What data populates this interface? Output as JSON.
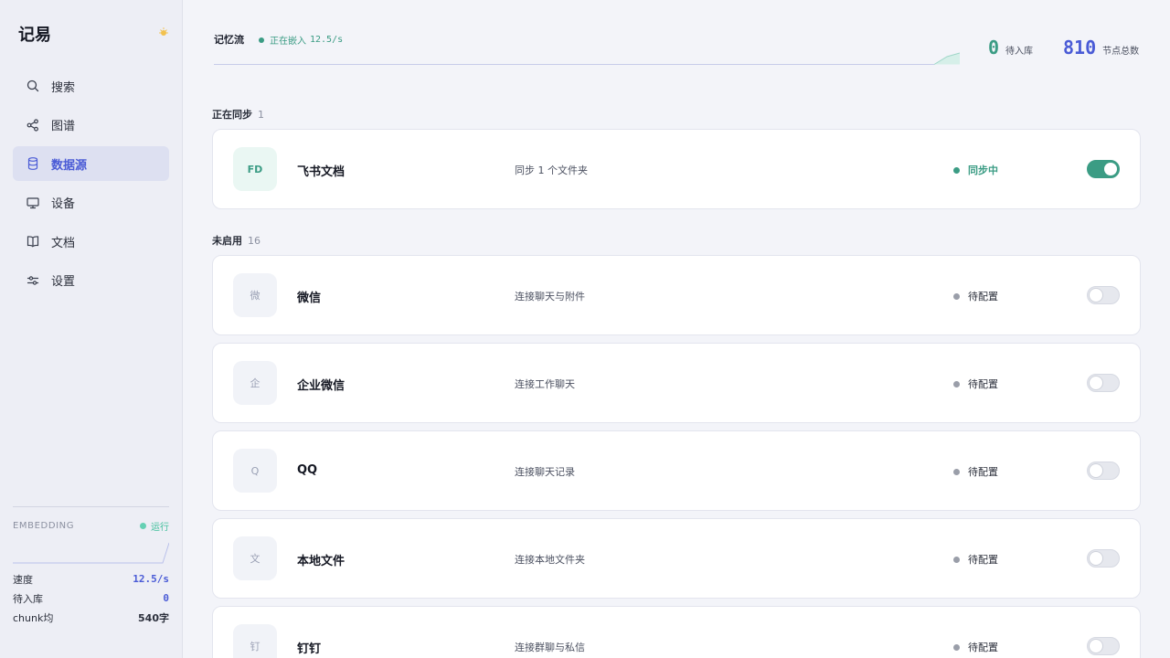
{
  "app": {
    "brand": "记易"
  },
  "sidebar": {
    "items": [
      {
        "label": "搜索",
        "icon": "search-icon"
      },
      {
        "label": "图谱",
        "icon": "share-icon"
      },
      {
        "label": "数据源",
        "icon": "database-icon",
        "active": true
      },
      {
        "label": "设备",
        "icon": "monitor-icon"
      },
      {
        "label": "文档",
        "icon": "book-icon"
      },
      {
        "label": "设置",
        "icon": "sliders-icon"
      }
    ],
    "embedding": {
      "title": "EMBEDDING",
      "status": "运行",
      "stats": [
        {
          "label": "速度",
          "value": "12.5/s"
        },
        {
          "label": "待入库",
          "value": "0"
        },
        {
          "label": "chunk均",
          "value": "540字"
        }
      ]
    }
  },
  "header": {
    "title": "记忆流",
    "status_text": "正在嵌入",
    "status_rate": "12.5/s",
    "pending": {
      "value": "0",
      "label": "待入库"
    },
    "total": {
      "value": "810",
      "label": "节点总数"
    }
  },
  "sections": {
    "syncing": {
      "label": "正在同步",
      "count": "1"
    },
    "disabled": {
      "label": "未启用",
      "count": "16"
    }
  },
  "sources": [
    {
      "avatar": "FD",
      "name": "飞书文档",
      "desc": "同步 1 个文件夹",
      "status": "同步中",
      "enabled": true
    },
    {
      "avatar": "微",
      "name": "微信",
      "desc": "连接聊天与附件",
      "status": "待配置",
      "enabled": false
    },
    {
      "avatar": "企",
      "name": "企业微信",
      "desc": "连接工作聊天",
      "status": "待配置",
      "enabled": false
    },
    {
      "avatar": "Q",
      "name": "QQ",
      "desc": "连接聊天记录",
      "status": "待配置",
      "enabled": false
    },
    {
      "avatar": "文",
      "name": "本地文件",
      "desc": "连接本地文件夹",
      "status": "待配置",
      "enabled": false
    },
    {
      "avatar": "钉",
      "name": "钉钉",
      "desc": "连接群聊与私信",
      "status": "待配置",
      "enabled": false
    }
  ],
  "colors": {
    "accent": "#4a5bd6",
    "success": "#3b9c84",
    "idle": "#9a9ea9"
  }
}
